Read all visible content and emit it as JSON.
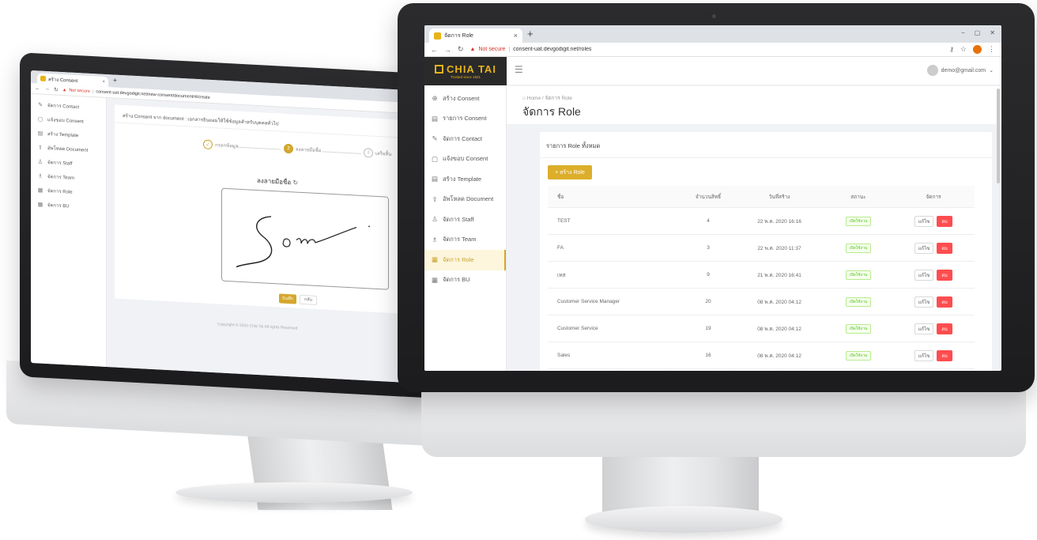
{
  "left_monitor": {
    "tab_title": "สร้าง Consent",
    "url_warning": "Not secure",
    "url": "consent-uat.devgodigit.net/new-consent/document/4/create",
    "sidebar": [
      {
        "icon": "edit-icon",
        "glyph": "✎",
        "label": "จัดการ Contact"
      },
      {
        "icon": "doc-icon",
        "glyph": "▢",
        "label": "แจ้งขอบ Consent"
      },
      {
        "icon": "template-icon",
        "glyph": "▤",
        "label": "สร้าง Template"
      },
      {
        "icon": "upload-icon",
        "glyph": "⇪",
        "label": "อัพโหลด Document"
      },
      {
        "icon": "user-icon",
        "glyph": "♙",
        "label": "จัดการ Staff"
      },
      {
        "icon": "team-icon",
        "glyph": "♗",
        "label": "จัดการ Team"
      },
      {
        "icon": "role-icon",
        "glyph": "▦",
        "label": "จัดการ Role"
      },
      {
        "icon": "bu-icon",
        "glyph": "▦",
        "label": "จัดการ BU"
      }
    ],
    "header_text": "สร้าง Consent จาก document : เอกสารยินยอมให้ใช้ข้อมูลสำหรับบุคคลทั่วไป",
    "steps": [
      {
        "label": "กรอกข้อมูล",
        "mark": "✓",
        "state": "done"
      },
      {
        "label": "ลงลายมือชื่อ",
        "mark": "2",
        "state": "active"
      },
      {
        "label": "เสร็จสิ้น",
        "mark": "3",
        "state": "todo"
      }
    ],
    "signature_title": "ลงลายมือชื่อ",
    "buttons": {
      "save": "บันทึก",
      "back": "กลับ"
    },
    "footer": "Copyright © 2020 Chia Tai All rights Reserved"
  },
  "right_monitor": {
    "tab_title": "จัดการ Role",
    "url_warning": "Not secure",
    "url": "consent-uat.devgodigit.net/roles",
    "logo": {
      "main": "CHIA TAI",
      "sub": "Trusted since 1921"
    },
    "user_email": "demo@gmail.com",
    "sidebar": [
      {
        "icon": "plus-circle-icon",
        "glyph": "⊕",
        "label": "สร้าง Consent"
      },
      {
        "icon": "list-icon",
        "glyph": "▤",
        "label": "รายการ Consent"
      },
      {
        "icon": "edit-icon",
        "glyph": "✎",
        "label": "จัดการ Contact"
      },
      {
        "icon": "doc-icon",
        "glyph": "▢",
        "label": "แจ้งขอบ Consent"
      },
      {
        "icon": "template-icon",
        "glyph": "▤",
        "label": "สร้าง Template"
      },
      {
        "icon": "upload-icon",
        "glyph": "⇪",
        "label": "อัพโหลด Document"
      },
      {
        "icon": "user-icon",
        "glyph": "♙",
        "label": "จัดการ Staff"
      },
      {
        "icon": "team-icon",
        "glyph": "♗",
        "label": "จัดการ Team"
      },
      {
        "icon": "role-icon",
        "glyph": "▦",
        "label": "จัดการ Role",
        "active": true
      },
      {
        "icon": "bu-icon",
        "glyph": "▦",
        "label": "จัดการ BU"
      }
    ],
    "breadcrumb": {
      "home": "Home",
      "sep": "/",
      "current": "จัดการ Role"
    },
    "page_title": "จัดการ Role",
    "card_title": "รายการ Role ทั้งหมด",
    "create_button": "+ สร้าง Role",
    "table": {
      "headers": [
        "ชื่อ",
        "จำนวนสิทธิ์",
        "วันที่สร้าง",
        "สถานะ",
        "จัดการ"
      ],
      "rows": [
        {
          "name": "TEST",
          "count": "4",
          "date": "22 พ.ค. 2020 16:16",
          "status": "เปิดใช้งาน"
        },
        {
          "name": "FA",
          "count": "3",
          "date": "22 พ.ค. 2020 11:37",
          "status": "เปิดใช้งาน"
        },
        {
          "name": "เทส",
          "count": "9",
          "date": "21 พ.ค. 2020 16:41",
          "status": "เปิดใช้งาน"
        },
        {
          "name": "Customer Service Manager",
          "count": "20",
          "date": "08 พ.ค. 2020 04:12",
          "status": "เปิดใช้งาน"
        },
        {
          "name": "Customer Service",
          "count": "19",
          "date": "08 พ.ค. 2020 04:12",
          "status": "เปิดใช้งาน"
        },
        {
          "name": "Sales",
          "count": "16",
          "date": "08 พ.ค. 2020 04:12",
          "status": "เปิดใช้งาน"
        }
      ],
      "edit_label": "แก้ไข",
      "delete_label": "ลบ"
    }
  }
}
